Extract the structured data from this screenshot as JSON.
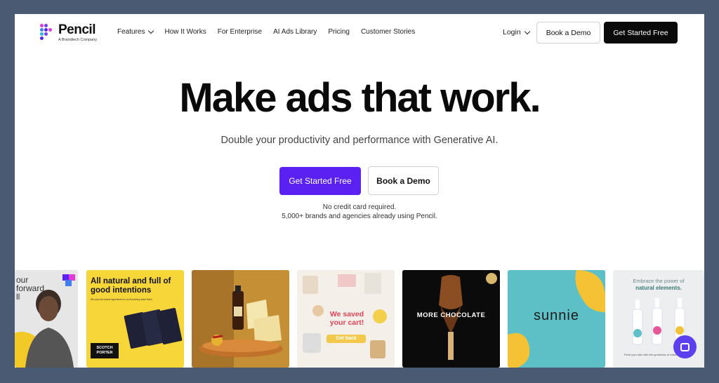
{
  "logo": {
    "name": "Pencil",
    "tagline": "A Brandtech Company"
  },
  "nav": {
    "links": [
      {
        "label": "Features",
        "dropdown": true
      },
      {
        "label": "How It Works"
      },
      {
        "label": "For Enterprise"
      },
      {
        "label": "AI Ads Library"
      },
      {
        "label": "Pricing"
      },
      {
        "label": "Customer Stories"
      }
    ],
    "login": "Login",
    "demo_label": "Book a Demo",
    "start_label": "Get Started Free"
  },
  "hero": {
    "title": "Make ads that work.",
    "subtitle": "Double your productivity and performance with Generative AI.",
    "primary_cta": "Get Started Free",
    "secondary_cta": "Book a Demo",
    "note_1": "No credit card required.",
    "note_2": "5,000+ brands and agencies already using Pencil."
  },
  "ads": {
    "card1_text": "our\nforward\nll",
    "card2_heading": "All natural and full of good intentions",
    "card2_small": "We only use natural ingredients for our flourishing beard finish.",
    "card2_brand": "SCOTCH PORTER",
    "card4_text": "We saved your cart!",
    "card4_cta": "Get back",
    "card5_text": "MORE CHOCOLATE",
    "card6_text": "sunnie",
    "card7_heading": "Embrace the power of",
    "card7_bold": "natural elements.",
    "card7_caption": "Feed your skin with the goodness of natural ingredients"
  },
  "colors": {
    "primary": "#5b21f2",
    "dark_button": "#0a0a0a",
    "background": "#4a5a72"
  }
}
